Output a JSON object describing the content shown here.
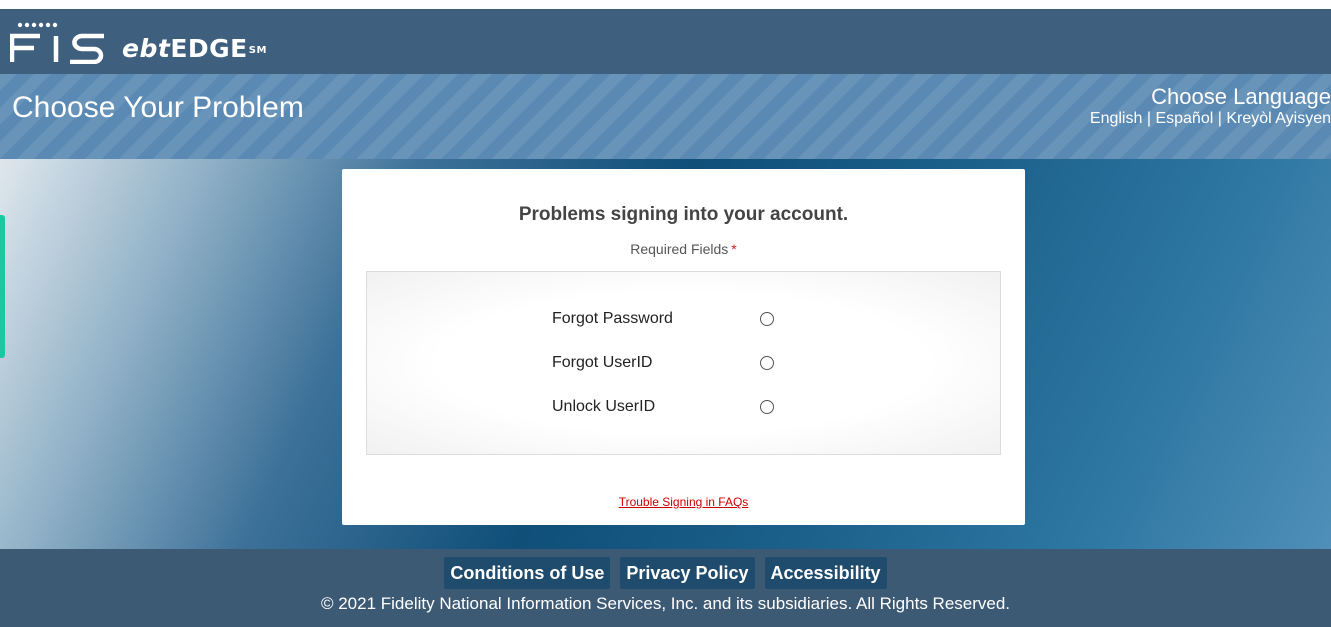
{
  "header": {
    "logo_fis": "FIS",
    "logo_ebt": "ebt",
    "logo_edge": "EDGE",
    "logo_sm": "SM"
  },
  "banner": {
    "title": "Choose Your Problem",
    "language_title": "Choose Language",
    "languages": [
      "English",
      "Español",
      "Kreyòl Ayisyen"
    ],
    "separator": "|"
  },
  "card": {
    "title": "Problems signing into your account.",
    "required_label": "Required Fields",
    "required_star": "*",
    "options": [
      {
        "label": "Forgot Password"
      },
      {
        "label": "Forgot UserID"
      },
      {
        "label": "Unlock UserID"
      }
    ],
    "faq_link": "Trouble Signing in FAQs"
  },
  "footer": {
    "links": [
      "Conditions of Use",
      "Privacy Policy",
      "Accessibility"
    ],
    "copyright": "© 2021 Fidelity National Information Services, Inc. and its subsidiaries. All Rights Reserved."
  },
  "colors": {
    "header_bg": "#3f5f7f",
    "banner_bg": "#5a89b3",
    "footer_bg": "#3d5a75",
    "footer_button_bg": "#1f4b6d",
    "link_red": "#cc0000",
    "side_tab": "#1cc8a0"
  }
}
